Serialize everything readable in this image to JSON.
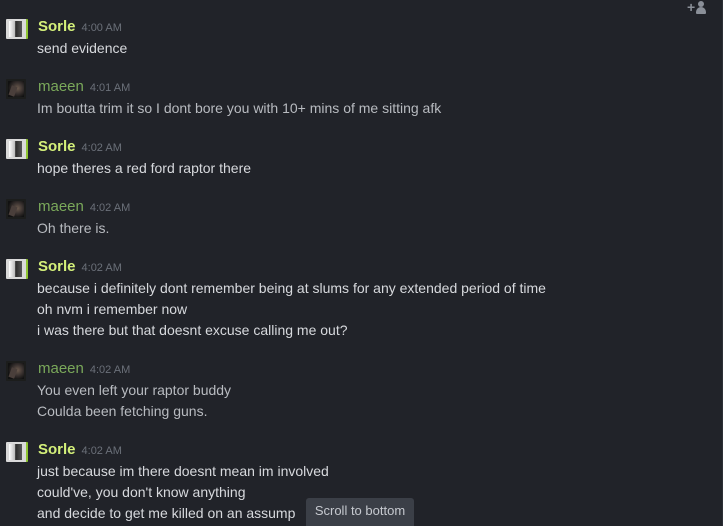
{
  "chat": {
    "add_user_icon": "add-user-icon",
    "scroll_to_bottom_label": "Scroll to bottom",
    "users": {
      "sorle": {
        "name": "Sorle",
        "color": "#d4f07a"
      },
      "maeen": {
        "name": "maeen",
        "color": "#7aa85a"
      }
    },
    "groups": [
      {
        "user": "sorle",
        "time": "4:00 AM",
        "lines": [
          "send evidence"
        ]
      },
      {
        "user": "maeen",
        "time": "4:01 AM",
        "lines": [
          "Im boutta trim it so I dont bore you with 10+ mins of me sitting afk"
        ]
      },
      {
        "user": "sorle",
        "time": "4:02 AM",
        "lines": [
          "hope theres a red ford raptor there"
        ]
      },
      {
        "user": "maeen",
        "time": "4:02 AM",
        "lines": [
          "Oh there is."
        ]
      },
      {
        "user": "sorle",
        "time": "4:02 AM",
        "lines": [
          "because i definitely dont remember being at slums for any extended period of time",
          "oh nvm i remember now",
          "i was there but that doesnt excuse calling me out?"
        ]
      },
      {
        "user": "maeen",
        "time": "4:02 AM",
        "lines": [
          "You even left your raptor buddy",
          "Coulda been fetching guns."
        ]
      },
      {
        "user": "sorle",
        "time": "4:02 AM",
        "lines": [
          "just because im there doesnt mean im involved",
          "could've, you don't know anything",
          "and decide to get me killed on an assump"
        ]
      }
    ]
  }
}
